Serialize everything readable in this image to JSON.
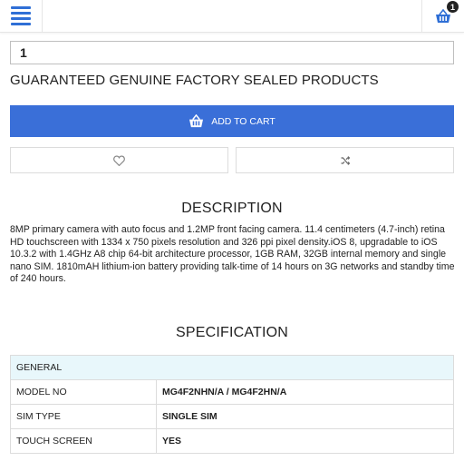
{
  "header": {
    "menu_icon": "hamburger-menu-icon",
    "cart_icon": "shopping-basket-icon",
    "cart_count": "1",
    "accent": "#2f6fd6"
  },
  "product": {
    "quantity": "1",
    "guarantee_text": "GUARANTEED GENUINE FACTORY SEALED PRODUCTS",
    "add_to_cart_label": "ADD TO CART",
    "add_to_cart_color": "#3a6fd8",
    "wishlist_icon": "heart-icon",
    "compare_icon": "shuffle-icon"
  },
  "description": {
    "title": "DESCRIPTION",
    "text": "8MP primary camera with auto focus and 1.2MP front facing camera. 11.4 centimeters (4.7-inch) retina HD touchscreen with 1334 x 750 pixels resolution and 326 ppi pixel density.iOS 8, upgradable to iOS 10.3.2 with 1.4GHz A8 chip 64-bit architecture processor, 1GB RAM, 32GB internal memory and single nano SIM. 1810mAH lithium-ion battery providing talk-time of 14 hours on 3G networks and standby time of 240 hours."
  },
  "specification": {
    "title": "SPECIFICATION",
    "group": "GENERAL",
    "rows": [
      {
        "key": "MODEL NO",
        "value": "MG4F2NHN/A / MG4F2HN/A"
      },
      {
        "key": "SIM TYPE",
        "value": "SINGLE SIM"
      },
      {
        "key": "TOUCH SCREEN",
        "value": "YES"
      }
    ]
  }
}
